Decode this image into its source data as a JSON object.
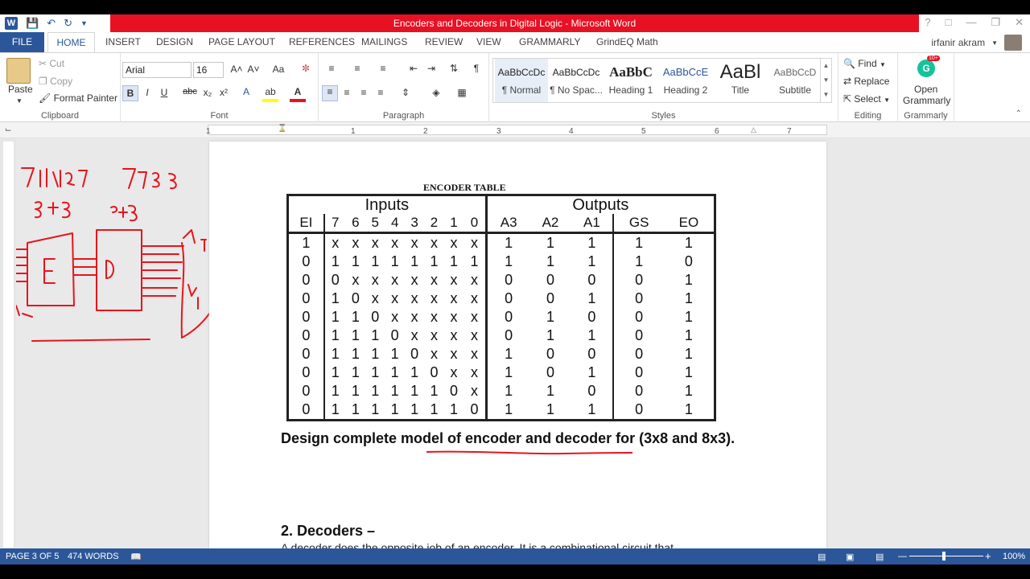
{
  "window": {
    "title": "Encoders and Decoders in Digital Logic - Microsoft Word",
    "user": "irfanir akram"
  },
  "tabs": [
    "FILE",
    "HOME",
    "INSERT",
    "DESIGN",
    "PAGE LAYOUT",
    "REFERENCES",
    "MAILINGS",
    "REVIEW",
    "VIEW",
    "GRAMMARLY",
    "GrindEQ Math"
  ],
  "ribbon": {
    "clipboard": {
      "paste": "Paste",
      "cut": "Cut",
      "copy": "Copy",
      "format_painter": "Format Painter",
      "label": "Clipboard"
    },
    "font": {
      "name": "Arial",
      "size": "16",
      "label": "Font",
      "aa": "Aa",
      "bold": "B",
      "italic": "I",
      "underline": "U",
      "strike": "abc",
      "sub": "x₂",
      "sup": "x²"
    },
    "paragraph": {
      "label": "Paragraph"
    },
    "styles": {
      "label": "Styles",
      "items": [
        {
          "sample": "AaBbCcDc",
          "name": "¶ Normal"
        },
        {
          "sample": "AaBbCcDc",
          "name": "¶ No Spac..."
        },
        {
          "sample": "AaBbC",
          "name": "Heading 1"
        },
        {
          "sample": "AaBbCcE",
          "name": "Heading 2"
        },
        {
          "sample": "AaBl",
          "name": "Title"
        },
        {
          "sample": "AaBbCcD",
          "name": "Subtitle"
        }
      ]
    },
    "editing": {
      "find": "Find",
      "replace": "Replace",
      "select": "Select",
      "label": "Editing"
    },
    "grammarly": {
      "open": "Open",
      "name": "Grammarly",
      "badge": "10+",
      "label": "Grammarly"
    }
  },
  "ruler": {
    "numbers": [
      "1",
      "1",
      "2",
      "3",
      "4",
      "5",
      "6",
      "7"
    ]
  },
  "document": {
    "encoder_title": "ENCODER TABLE",
    "table": {
      "group_headers": [
        "Inputs",
        "Outputs"
      ],
      "columns": [
        "EI",
        "7",
        "6",
        "5",
        "4",
        "3",
        "2",
        "1",
        "0",
        "A3",
        "A2",
        "A1",
        "GS",
        "EO"
      ],
      "rows": [
        [
          "1",
          "x",
          "x",
          "x",
          "x",
          "x",
          "x",
          "x",
          "x",
          "1",
          "1",
          "1",
          "1",
          "1"
        ],
        [
          "0",
          "1",
          "1",
          "1",
          "1",
          "1",
          "1",
          "1",
          "1",
          "1",
          "1",
          "1",
          "1",
          "0"
        ],
        [
          "0",
          "0",
          "x",
          "x",
          "x",
          "x",
          "x",
          "x",
          "x",
          "0",
          "0",
          "0",
          "0",
          "1"
        ],
        [
          "0",
          "1",
          "0",
          "x",
          "x",
          "x",
          "x",
          "x",
          "x",
          "0",
          "0",
          "1",
          "0",
          "1"
        ],
        [
          "0",
          "1",
          "1",
          "0",
          "x",
          "x",
          "x",
          "x",
          "x",
          "0",
          "1",
          "0",
          "0",
          "1"
        ],
        [
          "0",
          "1",
          "1",
          "1",
          "0",
          "x",
          "x",
          "x",
          "x",
          "0",
          "1",
          "1",
          "0",
          "1"
        ],
        [
          "0",
          "1",
          "1",
          "1",
          "1",
          "0",
          "x",
          "x",
          "x",
          "1",
          "0",
          "0",
          "0",
          "1"
        ],
        [
          "0",
          "1",
          "1",
          "1",
          "1",
          "1",
          "0",
          "x",
          "x",
          "1",
          "0",
          "1",
          "0",
          "1"
        ],
        [
          "0",
          "1",
          "1",
          "1",
          "1",
          "1",
          "1",
          "0",
          "x",
          "1",
          "1",
          "0",
          "0",
          "1"
        ],
        [
          "0",
          "1",
          "1",
          "1",
          "1",
          "1",
          "1",
          "1",
          "0",
          "1",
          "1",
          "1",
          "0",
          "1"
        ]
      ]
    },
    "design_heading": "Design complete model of encoder and decoder for (3x8 and 8x3).",
    "section_heading": "2. Decoders –",
    "body_text": "A decoder does the opposite job of an encoder. It is a combinational circuit that",
    "annotations": {
      "chip1": "74LS148",
      "chip2": "74LS138",
      "label1": "8÷3",
      "label2": "3÷8",
      "e": "E",
      "d": "D"
    }
  },
  "status": {
    "page": "PAGE 3 OF 5",
    "words": "474 WORDS",
    "zoom": "100%"
  },
  "colors": {
    "accent": "#2b579a",
    "title_bar": "#e81123",
    "ink": "#e8141c"
  }
}
